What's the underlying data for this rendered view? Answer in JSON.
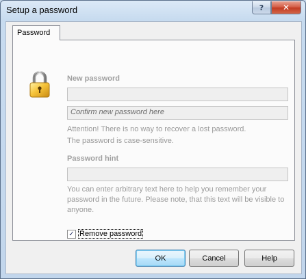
{
  "window": {
    "title": "Setup a password",
    "help_button": "?",
    "close_button": "✕"
  },
  "tab": {
    "label": "Password"
  },
  "icon": "padlock-icon",
  "new_password": {
    "label": "New password",
    "value": "",
    "confirm_placeholder": "Confirm new password here"
  },
  "notes": {
    "line1": "Attention! There is no way to recover a lost password.",
    "line2": "The password is case-sensitive."
  },
  "hint": {
    "label": "Password hint",
    "value": "",
    "note_line1": "You can enter arbitrary text here to help you remember your",
    "note_line2": "password in the future. Please note, that this text will be visible to",
    "note_line3": "anyone."
  },
  "remove_password": {
    "label": "Remove password",
    "checked": true,
    "check_glyph": "✓"
  },
  "buttons": {
    "ok": "OK",
    "cancel": "Cancel",
    "help": "Help"
  }
}
